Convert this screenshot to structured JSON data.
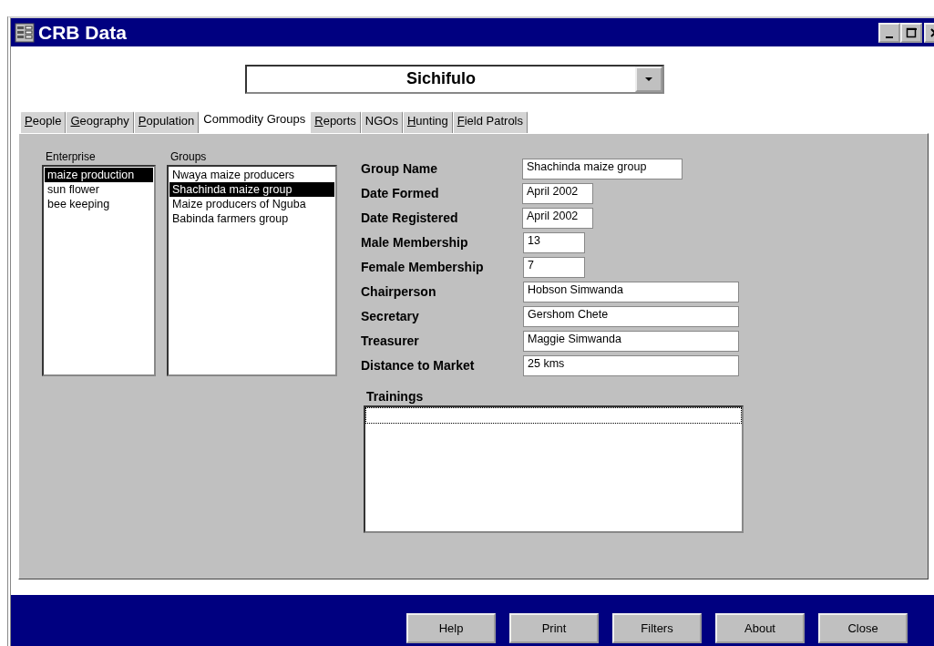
{
  "window": {
    "title": "CRB Data"
  },
  "location_combo": {
    "value": "Sichifulo"
  },
  "tabs": [
    {
      "label": "People",
      "mnemonic": true,
      "selected": false
    },
    {
      "label": "Geography",
      "mnemonic": true,
      "selected": false
    },
    {
      "label": "Population",
      "mnemonic": true,
      "selected": false
    },
    {
      "label": "Commodity Groups",
      "mnemonic": false,
      "selected": true
    },
    {
      "label": "Reports",
      "mnemonic": true,
      "selected": false
    },
    {
      "label": "NGOs",
      "mnemonic": false,
      "selected": false
    },
    {
      "label": "Hunting",
      "mnemonic": true,
      "selected": false
    },
    {
      "label": "Field Patrols",
      "mnemonic": true,
      "selected": false
    }
  ],
  "enterprise": {
    "label": "Enterprise",
    "items": [
      {
        "text": "maize production",
        "selected": true
      },
      {
        "text": "sun flower",
        "selected": false
      },
      {
        "text": "bee keeping",
        "selected": false
      }
    ]
  },
  "groups": {
    "label": "Groups",
    "items": [
      {
        "text": "Nwaya maize producers",
        "selected": false
      },
      {
        "text": "Shachinda maize group",
        "selected": true
      },
      {
        "text": "Maize producers of Nguba",
        "selected": false
      },
      {
        "text": "Babinda farmers group",
        "selected": false
      }
    ]
  },
  "fields": [
    {
      "label": "Group Name",
      "value": "Shachinda maize group"
    },
    {
      "label": "Date Formed",
      "value": "April 2002"
    },
    {
      "label": "Date Registered",
      "value": "April 2002"
    },
    {
      "label": "Male Membership",
      "value": "13"
    },
    {
      "label": "Female Membership",
      "value": "7"
    },
    {
      "label": "Chairperson",
      "value": "Hobson Simwanda"
    },
    {
      "label": "Secretary",
      "value": "Gershom Chete"
    },
    {
      "label": "Treasurer",
      "value": "Maggie Simwanda"
    },
    {
      "label": "Distance to Market",
      "value": "25 kms"
    }
  ],
  "trainings": {
    "label": "Trainings"
  },
  "buttons": [
    "Help",
    "Print",
    "Filters",
    "About",
    "Close"
  ]
}
